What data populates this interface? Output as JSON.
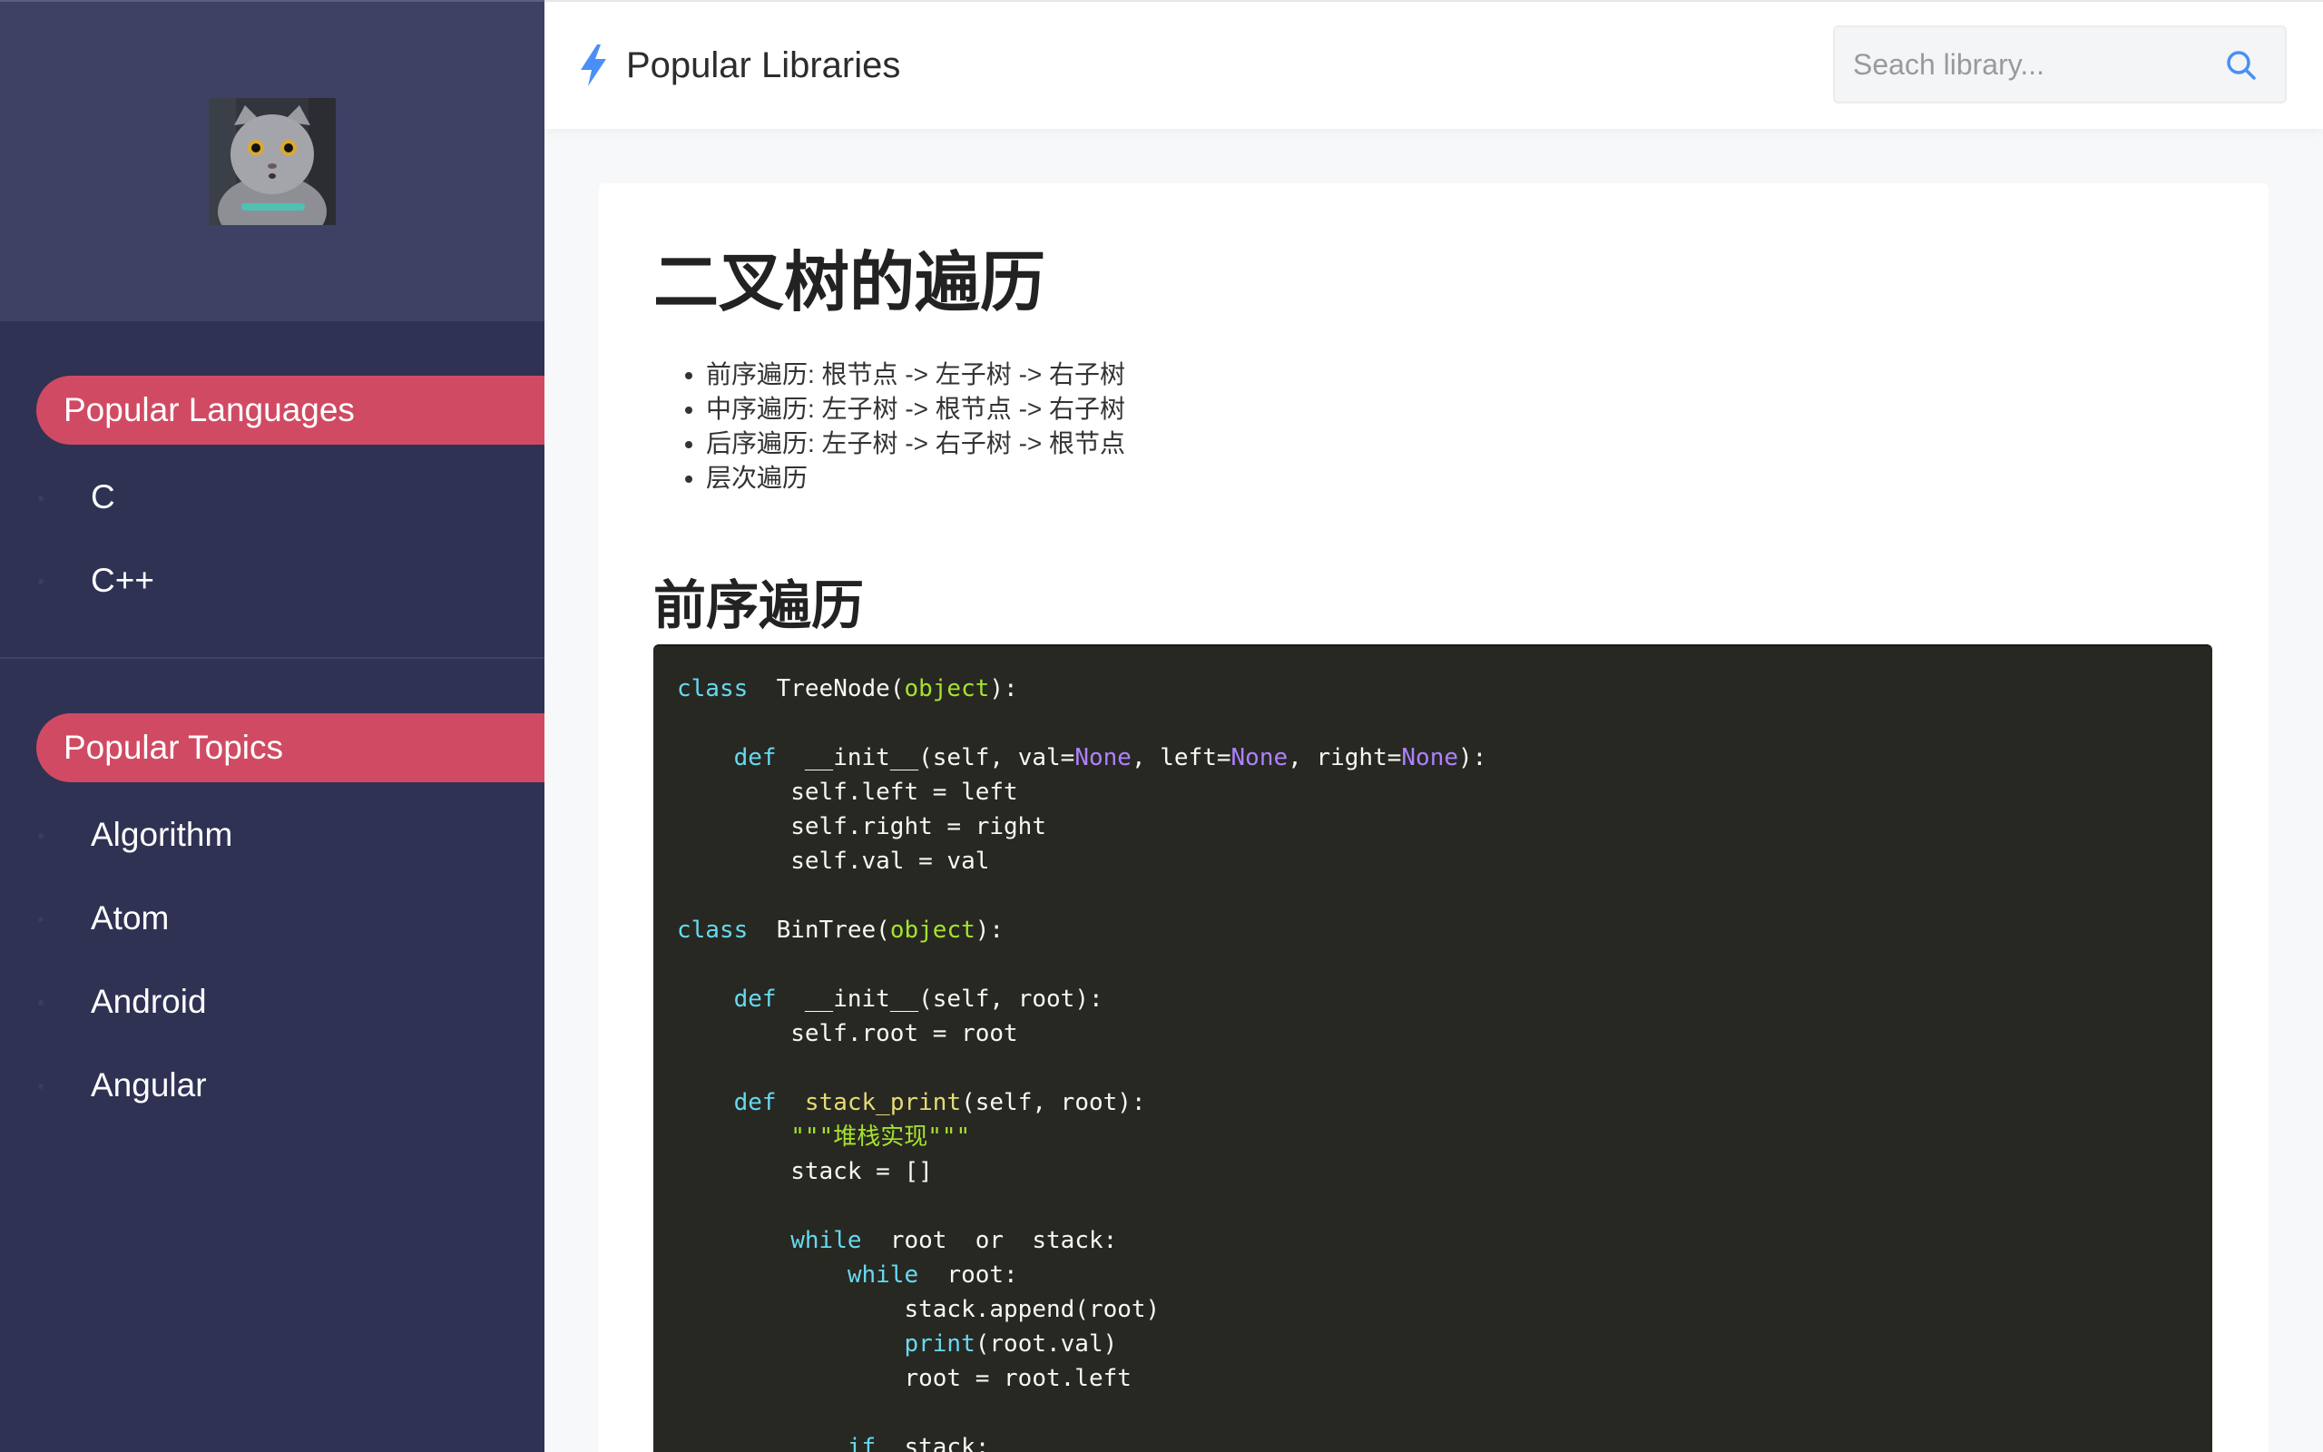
{
  "header": {
    "title": "Popular Libraries",
    "search_placeholder": "Seach library..."
  },
  "sidebar": {
    "sections": [
      {
        "title": "Popular Languages",
        "items": [
          "C",
          "C++"
        ]
      },
      {
        "title": "Popular Topics",
        "items": [
          "Algorithm",
          "Atom",
          "Android",
          "Angular"
        ]
      }
    ]
  },
  "content": {
    "title": "二叉树的遍历",
    "bullets": [
      "前序遍历: 根节点 -> 左子树 -> 右子树",
      "中序遍历: 左子树 -> 根节点 -> 右子树",
      "后序遍历: 左子树 -> 右子树 -> 根节点",
      "层次遍历"
    ],
    "section_title": "前序遍历",
    "code": [
      [
        [
          "kw",
          "class"
        ],
        [
          "",
          "  TreeNode("
        ],
        [
          "bi",
          "object"
        ],
        [
          "",
          "):"
        ]
      ],
      [
        [
          "",
          ""
        ]
      ],
      [
        [
          "",
          "    "
        ],
        [
          "kw",
          "def"
        ],
        [
          "",
          "  __init__(self, val="
        ],
        [
          "cn",
          "None"
        ],
        [
          "",
          ", left="
        ],
        [
          "cn",
          "None"
        ],
        [
          "",
          ", right="
        ],
        [
          "cn",
          "None"
        ],
        [
          "",
          "):"
        ]
      ],
      [
        [
          "",
          "        self.left = left"
        ]
      ],
      [
        [
          "",
          "        self.right = right"
        ]
      ],
      [
        [
          "",
          "        self.val = val"
        ]
      ],
      [
        [
          "",
          ""
        ]
      ],
      [
        [
          "kw",
          "class"
        ],
        [
          "",
          "  BinTree("
        ],
        [
          "bi",
          "object"
        ],
        [
          "",
          "):"
        ]
      ],
      [
        [
          "",
          ""
        ]
      ],
      [
        [
          "",
          "    "
        ],
        [
          "kw",
          "def"
        ],
        [
          "",
          "  __init__(self, root):"
        ]
      ],
      [
        [
          "",
          "        self.root = root"
        ]
      ],
      [
        [
          "",
          ""
        ]
      ],
      [
        [
          "",
          "    "
        ],
        [
          "kw",
          "def"
        ],
        [
          "",
          "  "
        ],
        [
          "fn",
          "stack_print"
        ],
        [
          "",
          "(self, root):"
        ]
      ],
      [
        [
          "",
          "        "
        ],
        [
          "st",
          "\"\"\"堆栈实现\"\"\""
        ]
      ],
      [
        [
          "",
          "        stack = []"
        ]
      ],
      [
        [
          "",
          ""
        ]
      ],
      [
        [
          "",
          "        "
        ],
        [
          "kw",
          "while"
        ],
        [
          "",
          "  root  or  stack:"
        ]
      ],
      [
        [
          "",
          "            "
        ],
        [
          "kw",
          "while"
        ],
        [
          "",
          "  root:"
        ]
      ],
      [
        [
          "",
          "                stack.append(root)"
        ]
      ],
      [
        [
          "",
          "                "
        ],
        [
          "kw",
          "print"
        ],
        [
          "",
          "(root.val)"
        ]
      ],
      [
        [
          "",
          "                root = root.left"
        ]
      ],
      [
        [
          "",
          ""
        ]
      ],
      [
        [
          "",
          "            "
        ],
        [
          "kw",
          "if"
        ],
        [
          "",
          "  stack:"
        ]
      ]
    ]
  },
  "colors": {
    "sidebar_bg": "#2f3253",
    "sidebar_head_bg": "#3e4163",
    "accent": "#d14a63",
    "bolt": "#4a8ff7",
    "code_bg": "#272822"
  }
}
